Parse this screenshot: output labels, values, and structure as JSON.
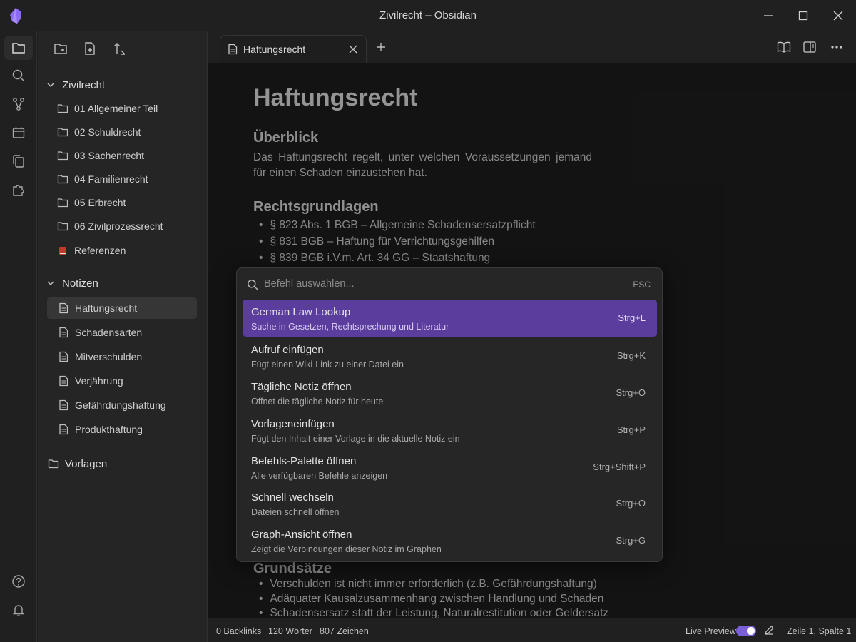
{
  "window": {
    "title": "Zivilrecht – Obsidian"
  },
  "ribbon": {
    "icons": [
      "files-icon",
      "search-icon",
      "graph-icon",
      "calendar-icon",
      "copy-icon",
      "plugin-icon",
      "help-icon",
      "bell-icon"
    ]
  },
  "sidebar": {
    "vault": "Zivilrecht",
    "vault_items": [
      {
        "label": "01 Allgemeiner Teil",
        "icon": "folder-icon"
      },
      {
        "label": "02 Schuldrecht",
        "icon": "folder-icon"
      },
      {
        "label": "03 Sachenrecht",
        "icon": "folder-icon"
      },
      {
        "label": "04 Familienrecht",
        "icon": "folder-icon"
      },
      {
        "label": "05 Erbrecht",
        "icon": "folder-icon"
      },
      {
        "label": "06 Zivilprozessrecht",
        "icon": "folder-icon"
      },
      {
        "label": "Referenzen",
        "icon": "book-icon"
      }
    ],
    "notes_folder": "Notizen",
    "notes": [
      {
        "label": "Haftungsrecht",
        "selected": true
      },
      {
        "label": "Schadensarten"
      },
      {
        "label": "Mitverschulden"
      },
      {
        "label": "Verjährung"
      },
      {
        "label": "Gefährdungshaftung"
      },
      {
        "label": "Produkthaftung"
      }
    ],
    "templates_folder": "Vorlagen"
  },
  "tab": {
    "title": "Haftungsrecht"
  },
  "note": {
    "title": "Haftungsrecht",
    "section1": "Überblick",
    "paragraph": "Das Haftungsrecht regelt, unter welchen Voraussetzungen jemand für einen Schaden einzustehen hat.",
    "section2": "Rechtsgrundlagen",
    "bullets1": [
      "§ 823 Abs. 1 BGB – Allgemeine Schadensersatzpflicht",
      "§ 831 BGB – Haftung für Verrichtungsgehilfen",
      "§ 839 BGB i.V.m. Art. 34 GG – Staatshaftung"
    ],
    "section3": "Grundsätze",
    "bullets2": [
      "Verschulden ist nicht immer erforderlich (z.B. Gefährdungshaftung)",
      "Adäquater Kausalzusammenhang zwischen Handlung und Schaden",
      "Schadensersatz statt der Leistung, Naturalrestitution oder Geldersatz"
    ]
  },
  "palette": {
    "placeholder": "Befehl auswählen...",
    "esc": "ESC",
    "commands": [
      {
        "name": "German Law Lookup",
        "desc": "Suche in Gesetzen, Rechtsprechung und Literatur",
        "key": "Strg+L",
        "selected": true
      },
      {
        "name": "Aufruf einfügen",
        "desc": "Fügt einen Wiki-Link zu einer Datei ein",
        "key": "Strg+K"
      },
      {
        "name": "Tägliche Notiz öffnen",
        "desc": "Öffnet die tägliche Notiz für heute",
        "key": "Strg+O"
      },
      {
        "name": "Vorlageneinfügen",
        "desc": "Fügt den Inhalt einer Vorlage in die aktuelle Notiz ein",
        "key": "Strg+P"
      },
      {
        "name": "Befehls-Palette öffnen",
        "desc": "Alle verfügbaren Befehle anzeigen",
        "key": "Strg+Shift+P"
      },
      {
        "name": "Schnell wechseln",
        "desc": "Dateien schnell öffnen",
        "key": "Strg+O"
      },
      {
        "name": "Graph-Ansicht öffnen",
        "desc": "Zeigt die Verbindungen dieser Notiz im Graphen",
        "key": "Strg+G"
      }
    ]
  },
  "status": {
    "backlinks": "0 Backlinks",
    "words": "120 Wörter",
    "chars": "807 Zeichen",
    "live_preview": "Live Preview",
    "live_preview_on": true,
    "cursor": "Zeile 1, Spalte 1"
  },
  "colors": {
    "accent": "#7b5fd9",
    "selected_command": "#5b3d9e"
  }
}
